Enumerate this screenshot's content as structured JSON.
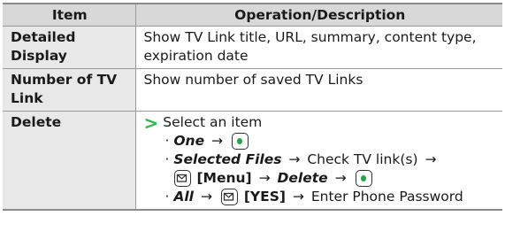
{
  "header": {
    "col_item": "Item",
    "col_desc": "Operation/Description"
  },
  "rows": [
    {
      "item": "Detailed Display",
      "desc": "Show TV Link title, URL, summary, content type, expiration date"
    },
    {
      "item": "Number of TV Link",
      "desc": "Show number of saved TV Links"
    },
    {
      "item": "Delete",
      "step_intro": "Select an item",
      "opt1": {
        "name": "One",
        "arrow": "→"
      },
      "opt2": {
        "name": "Selected Files",
        "arrow1": "→",
        "text": "Check TV link(s)",
        "arrow2": "→",
        "menu": "[Menu]",
        "arrow3": "→",
        "action": "Delete",
        "arrow4": "→"
      },
      "opt3": {
        "name": "All",
        "arrow1": "→",
        "yes": "[YES]",
        "arrow2": "→",
        "text": "Enter Phone Password"
      },
      "bullet": "·",
      "pointer": ">"
    }
  ],
  "icons": {
    "center_key": "center-key-icon",
    "mail_key": "mail-key-icon",
    "green_arrow": "green-arrow-icon"
  },
  "colors": {
    "header_bg": "#d8d8d8",
    "item_bg": "#e8e8e8",
    "accent_green": "#2fb84a"
  }
}
